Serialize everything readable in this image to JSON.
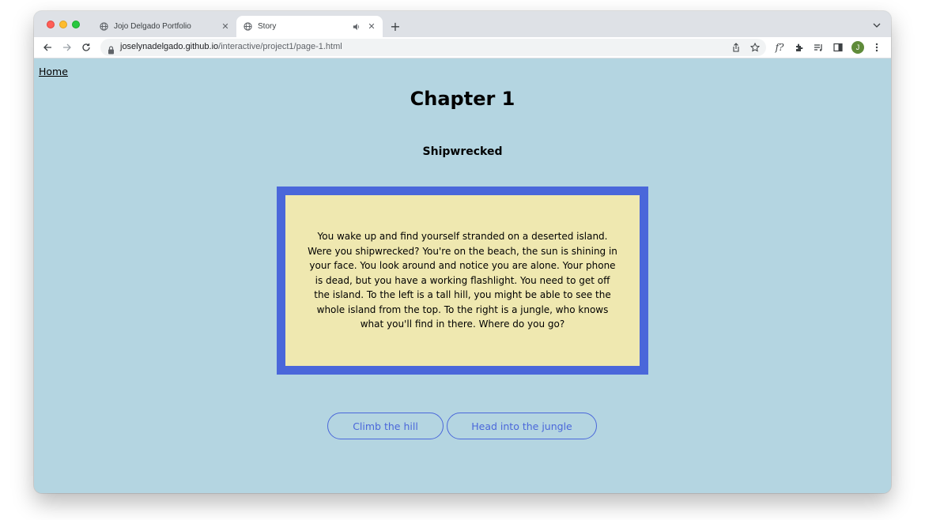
{
  "browser": {
    "tabs": [
      {
        "title": "Jojo Delgado Portfolio",
        "icon": "globe-icon",
        "active": false
      },
      {
        "title": "Story",
        "icon": "globe-icon",
        "active": true,
        "audio": true
      }
    ],
    "new_tab_label": "+",
    "url_host": "joselynadelgado.github.io",
    "url_path": "/interactive/project1/page-1.html",
    "extension_label": "f?",
    "profile_initial": "J"
  },
  "page": {
    "home_link": "Home",
    "chapter_title": "Chapter 1",
    "subtitle": "Shipwrecked",
    "story_text": "You wake up and find yourself stranded on a deserted island. Were you shipwrecked? You're on the beach, the sun is shining in your face. You look around and notice you are alone. Your phone is dead, but you have a working flashlight. You need to get off the island. To the left is a tall hill, you might be able to see the whole island from the top. To the right is a jungle, who knows what you'll find in there. Where do you go?",
    "choices": [
      {
        "label": "Climb the hill"
      },
      {
        "label": "Head into the jungle"
      }
    ]
  },
  "colors": {
    "page_bg": "#b4d5e1",
    "box_border": "#4a67da",
    "box_fill": "#efe8b0",
    "button_accent": "#4a67da"
  }
}
